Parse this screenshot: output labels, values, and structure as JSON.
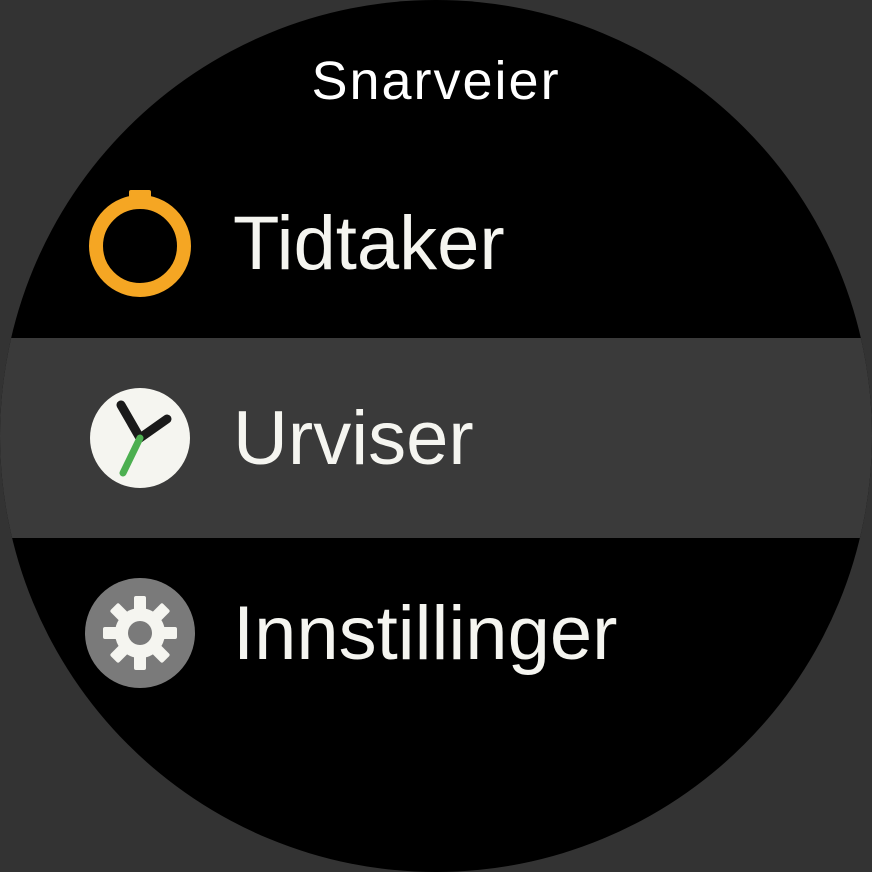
{
  "header": {
    "title": "Snarveier"
  },
  "menu": {
    "items": [
      {
        "label": "Tidtaker",
        "icon": "stopwatch-icon",
        "selected": false
      },
      {
        "label": "Urviser",
        "icon": "watchface-icon",
        "selected": true
      },
      {
        "label": "Innstillinger",
        "icon": "gear-icon",
        "selected": false
      }
    ]
  },
  "colors": {
    "accent_orange": "#f5a623",
    "accent_green": "#4caf50",
    "icon_white": "#f5f5f0",
    "icon_gray_bg": "#7a7a7a"
  }
}
